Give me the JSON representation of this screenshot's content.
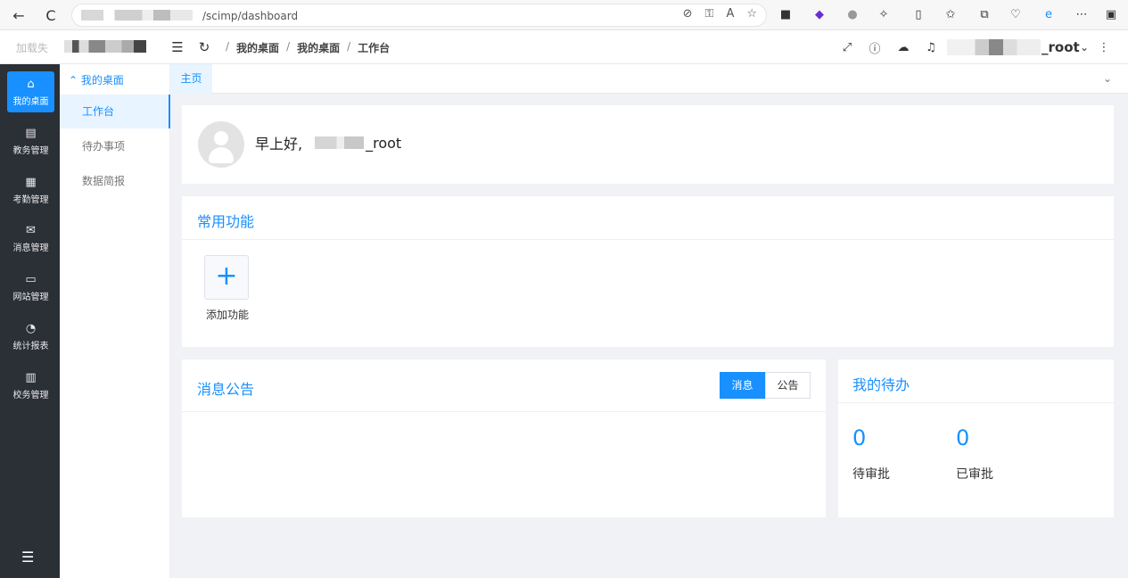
{
  "browser": {
    "url": "/scimp/dashboard",
    "nav": {
      "back": "←",
      "reload": "C"
    }
  },
  "header": {
    "loading_text": "加载失",
    "breadcrumb": [
      "我的桌面",
      "我的桌面",
      "工作台"
    ],
    "user_suffix": "_root"
  },
  "sidebar": {
    "items": [
      {
        "label": "我的桌面",
        "icon": "home-icon",
        "glyph": "⌂"
      },
      {
        "label": "教务管理",
        "icon": "document-icon",
        "glyph": "▤"
      },
      {
        "label": "考勤管理",
        "icon": "calendar-icon",
        "glyph": "▦"
      },
      {
        "label": "消息管理",
        "icon": "mail-icon",
        "glyph": "✉"
      },
      {
        "label": "网站管理",
        "icon": "monitor-icon",
        "glyph": "▭"
      },
      {
        "label": "统计报表",
        "icon": "pie-chart-icon",
        "glyph": "◔"
      },
      {
        "label": "校务管理",
        "icon": "printer-icon",
        "glyph": "▥"
      }
    ]
  },
  "submenu": {
    "group": "我的桌面",
    "items": [
      "工作台",
      "待办事项",
      "数据简报"
    ]
  },
  "tabs": {
    "home": "主页"
  },
  "welcome": {
    "greeting": "早上好,",
    "name_suffix": "_root"
  },
  "quick": {
    "title": "常用功能",
    "add_label": "添加功能"
  },
  "notices": {
    "title": "消息公告",
    "tab_message": "消息",
    "tab_notice": "公告"
  },
  "todo": {
    "title": "我的待办",
    "pending_count": "0",
    "pending_label": "待审批",
    "approved_count": "0",
    "approved_label": "已审批"
  },
  "colors": {
    "accent": "#1890ff",
    "sidebar_bg": "#2b2f36",
    "page_bg": "#f0f2f5"
  }
}
